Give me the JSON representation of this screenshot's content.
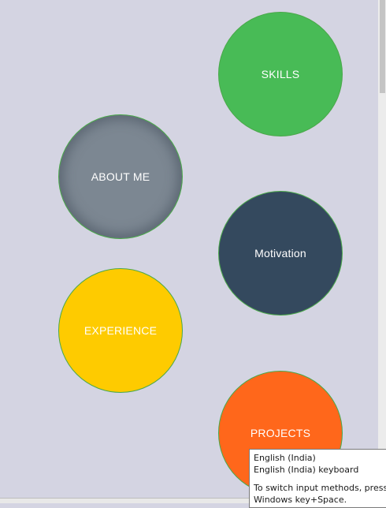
{
  "circles": {
    "skills": {
      "label": "SKILLS",
      "color": "#48bb56"
    },
    "about": {
      "label": "ABOUT ME",
      "color": "#7c8792"
    },
    "motivation": {
      "label": "Motivation",
      "color": "#34495e"
    },
    "experience": {
      "label": "EXPERIENCE",
      "color": "#fecb00"
    },
    "projects": {
      "label": "PROJECTS",
      "color": "#ff671b"
    }
  },
  "tooltip": {
    "language": "English (India)",
    "keyboard": "English (India) keyboard",
    "hint_line1": "To switch input methods, press",
    "hint_line2": "Windows key+Space."
  }
}
